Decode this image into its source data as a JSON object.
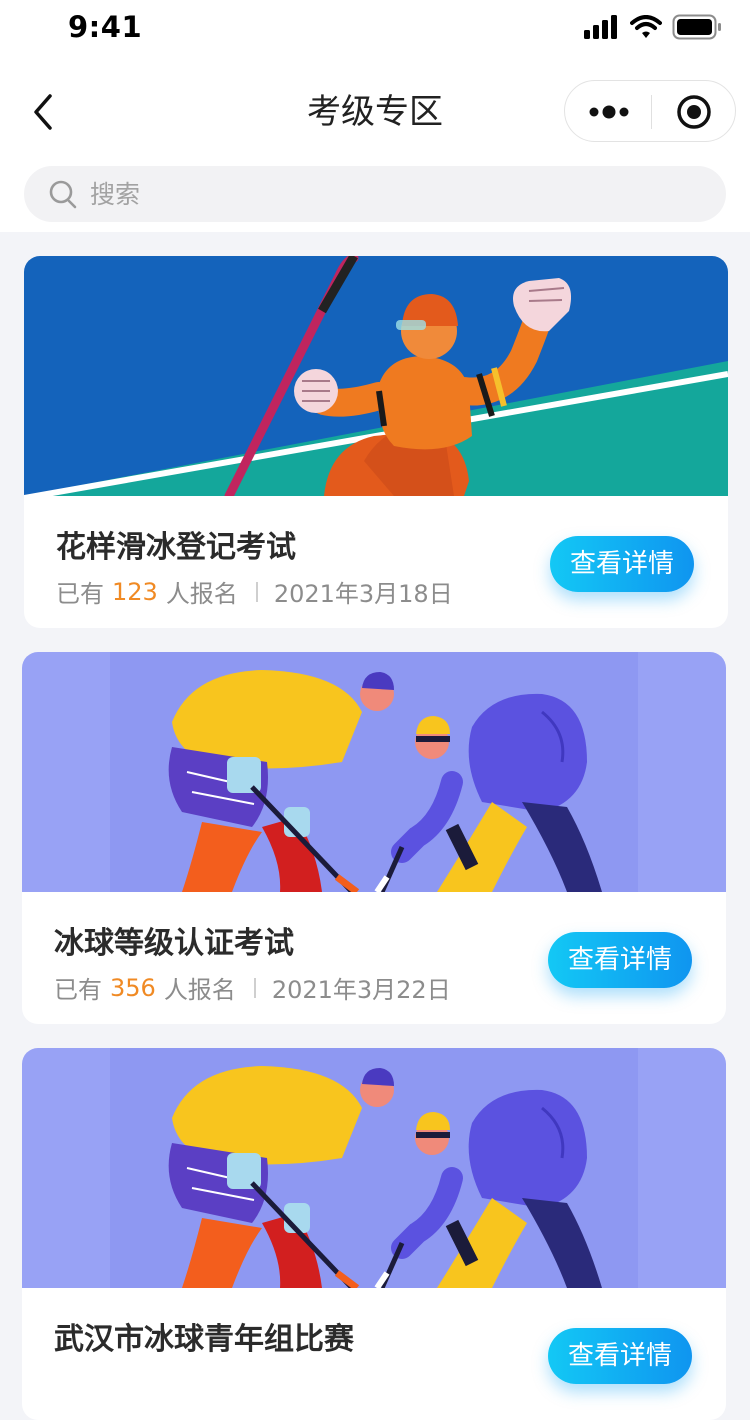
{
  "status_bar": {
    "time": "9:41",
    "icons": [
      "signal-icon",
      "wifi-icon",
      "battery-icon"
    ]
  },
  "nav": {
    "title": "考级专区",
    "back_icon": "chevron-left-icon",
    "more_icon": "more-dots-icon",
    "close_icon": "target-close-icon"
  },
  "search": {
    "placeholder": "搜索",
    "value": ""
  },
  "colors": {
    "accent": "#0f95f0",
    "count_highlight": "#f08a24",
    "background": "#f3f4f8"
  },
  "cards": [
    {
      "title": "花样滑冰登记考试",
      "meta_prefix": "已有",
      "count": "123",
      "meta_suffix": "人报名",
      "date": "2021年3月18日",
      "button_label": "查看详情"
    },
    {
      "title": "冰球等级认证考试",
      "meta_prefix": "已有",
      "count": "356",
      "meta_suffix": "人报名",
      "date": "2021年3月22日",
      "button_label": "查看详情"
    },
    {
      "title": "武汉市冰球青年组比赛",
      "meta_prefix": "",
      "count": "",
      "meta_suffix": "",
      "date": "",
      "button_label": "查看详情"
    }
  ]
}
